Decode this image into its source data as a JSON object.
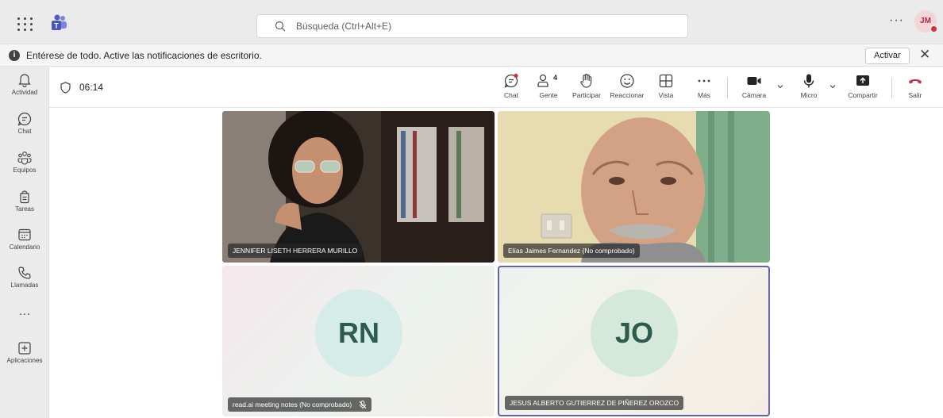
{
  "topbar": {
    "search_placeholder": "Búsqueda (Ctrl+Alt+E)",
    "more": "···",
    "avatar_initials": "JM"
  },
  "notification": {
    "message": "Entérese de todo. Active las notificaciones de escritorio.",
    "activate_label": "Activar",
    "close": "✕"
  },
  "rail": {
    "items": [
      {
        "label": "Actividad",
        "icon": "bell-icon"
      },
      {
        "label": "Chat",
        "icon": "chat-icon"
      },
      {
        "label": "Equipos",
        "icon": "teams-icon"
      },
      {
        "label": "Tareas",
        "icon": "tasks-icon"
      },
      {
        "label": "Calendario",
        "icon": "calendar-icon"
      },
      {
        "label": "Llamadas",
        "icon": "phone-icon"
      },
      {
        "label": "Aplicaciones",
        "icon": "apps-icon"
      }
    ],
    "more": "···"
  },
  "meeting": {
    "timer": "06:14",
    "toolbar": {
      "chat": "Chat",
      "people": "Gente",
      "people_count": "4",
      "raise": "Participar",
      "react": "Reaccionar",
      "view": "Vista",
      "more": "Más",
      "camera": "Cámara",
      "mic": "Micro",
      "share": "Compartir",
      "leave": "Salir"
    },
    "participants": [
      {
        "name": "JENNIFER LISETH HERRERA MURILLO",
        "video": true
      },
      {
        "name": "Elías Jaimes Fernandez (No comprobado)",
        "video": true
      },
      {
        "name": "read.ai meeting notes (No comprobado)",
        "initials": "RN",
        "muted": true
      },
      {
        "name": "JESUS ALBERTO GUTIERREZ DE PIÑEREZ OROZCO",
        "initials": "JO",
        "speaking": true
      }
    ]
  },
  "colors": {
    "accent": "#6264a7",
    "leave": "#c4314b",
    "notification_dot": "#d13438"
  }
}
